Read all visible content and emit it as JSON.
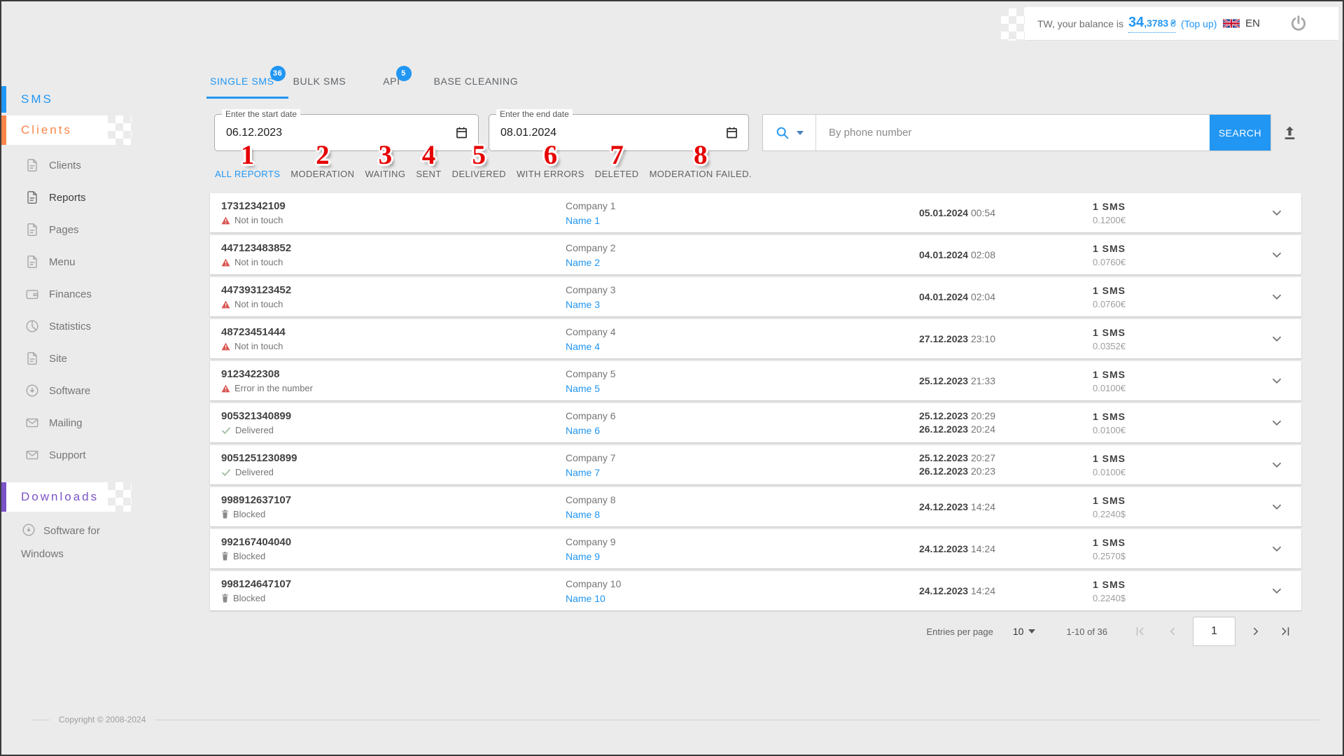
{
  "colors": {
    "accent": "#2196f3",
    "section-orange": "#f8854a",
    "section-purple": "#7a52c7",
    "marker-red": "#e60000",
    "warn-red": "#d9534f",
    "delivered-green": "#9bb89b"
  },
  "topbar": {
    "balance_prefix": "TW, your balance is",
    "balance_int": "34",
    "balance_frac": ",3783",
    "balance_currency": "₴",
    "topup_label": "(Top up)",
    "language": "EN"
  },
  "sidebar": {
    "section_sms": "SMS",
    "section_clients": "Clients",
    "section_downloads": "Downloads",
    "items": [
      {
        "label": "Clients",
        "icon": "document-icon"
      },
      {
        "label": "Reports",
        "icon": "document-icon"
      },
      {
        "label": "Pages",
        "icon": "document-icon"
      },
      {
        "label": "Menu",
        "icon": "document-icon"
      },
      {
        "label": "Finances",
        "icon": "wallet-icon"
      },
      {
        "label": "Statistics",
        "icon": "pie-chart-icon"
      },
      {
        "label": "Site",
        "icon": "document-icon"
      },
      {
        "label": "Software",
        "icon": "download-icon"
      },
      {
        "label": "Mailing",
        "icon": "envelope-icon"
      },
      {
        "label": "Support",
        "icon": "envelope-icon"
      }
    ],
    "downloads_item": "Software for Windows",
    "copyright": "Copyright © 2008-2024"
  },
  "tabs": [
    {
      "label": "SINGLE SMS",
      "badge": "36"
    },
    {
      "label": "BULK SMS",
      "badge": ""
    },
    {
      "label": "API",
      "badge": "5"
    },
    {
      "label": "BASE CLEANING",
      "badge": ""
    }
  ],
  "filters": {
    "start_date_label": "Enter the start date",
    "start_date_value": "06.12.2023",
    "end_date_label": "Enter the end date",
    "end_date_value": "08.01.2024",
    "search_placeholder": "By phone number",
    "search_button": "SEARCH",
    "links": [
      {
        "label": "ALL REPORTS",
        "marker": "1"
      },
      {
        "label": "MODERATION",
        "marker": "2"
      },
      {
        "label": "WAITING",
        "marker": "3"
      },
      {
        "label": "SENT",
        "marker": "4"
      },
      {
        "label": "DELIVERED",
        "marker": "5"
      },
      {
        "label": "WITH ERRORS",
        "marker": "6"
      },
      {
        "label": "DELETED",
        "marker": "7"
      },
      {
        "label": "MODERATION FAILED.",
        "marker": "8"
      }
    ]
  },
  "table": {
    "rows": [
      {
        "phone": "17312342109",
        "status": "Not in touch",
        "status_type": "warning",
        "company": "Company 1",
        "name": "Name 1",
        "date1": "05.01.2024",
        "time1": "00:54",
        "date2": "",
        "time2": "",
        "count": "1 SMS",
        "price": "0.1200€"
      },
      {
        "phone": "447123483852",
        "status": "Not in touch",
        "status_type": "warning",
        "company": "Company 2",
        "name": "Name 2",
        "date1": "04.01.2024",
        "time1": "02:08",
        "date2": "",
        "time2": "",
        "count": "1 SMS",
        "price": "0.0760€"
      },
      {
        "phone": "447393123452",
        "status": "Not in touch",
        "status_type": "warning",
        "company": "Company 3",
        "name": "Name 3",
        "date1": "04.01.2024",
        "time1": "02:04",
        "date2": "",
        "time2": "",
        "count": "1 SMS",
        "price": "0.0760€"
      },
      {
        "phone": "48723451444",
        "status": "Not in touch",
        "status_type": "warning",
        "company": "Company 4",
        "name": "Name 4",
        "date1": "27.12.2023",
        "time1": "23:10",
        "date2": "",
        "time2": "",
        "count": "1 SMS",
        "price": "0.0352€"
      },
      {
        "phone": "9123422308",
        "status": "Error in the number",
        "status_type": "warning",
        "company": "Company 5",
        "name": "Name 5",
        "date1": "25.12.2023",
        "time1": "21:33",
        "date2": "",
        "time2": "",
        "count": "1 SMS",
        "price": "0.0100€"
      },
      {
        "phone": "905321340899",
        "status": "Delivered",
        "status_type": "delivered",
        "company": "Company 6",
        "name": "Name 6",
        "date1": "25.12.2023",
        "time1": "20:29",
        "date2": "26.12.2023",
        "time2": "20:24",
        "count": "1 SMS",
        "price": "0.0100€"
      },
      {
        "phone": "9051251230899",
        "status": "Delivered",
        "status_type": "delivered",
        "company": "Company 7",
        "name": "Name 7",
        "date1": "25.12.2023",
        "time1": "20:27",
        "date2": "26.12.2023",
        "time2": "20:23",
        "count": "1 SMS",
        "price": "0.0100€"
      },
      {
        "phone": "998912637107",
        "status": "Blocked",
        "status_type": "blocked",
        "company": "Company 8",
        "name": "Name 8",
        "date1": "24.12.2023",
        "time1": "14:24",
        "date2": "",
        "time2": "",
        "count": "1 SMS",
        "price": "0.2240$"
      },
      {
        "phone": "992167404040",
        "status": "Blocked",
        "status_type": "blocked",
        "company": "Company 9",
        "name": "Name 9",
        "date1": "24.12.2023",
        "time1": "14:24",
        "date2": "",
        "time2": "",
        "count": "1 SMS",
        "price": "0.2570$"
      },
      {
        "phone": "998124647107",
        "status": "Blocked",
        "status_type": "blocked",
        "company": "Company 10",
        "name": "Name 10",
        "date1": "24.12.2023",
        "time1": "14:24",
        "date2": "",
        "time2": "",
        "count": "1 SMS",
        "price": "0.2240$"
      }
    ]
  },
  "pagination": {
    "entries_label": "Entries per page",
    "entries_value": "10",
    "range": "1-10 of 36",
    "page": "1"
  }
}
